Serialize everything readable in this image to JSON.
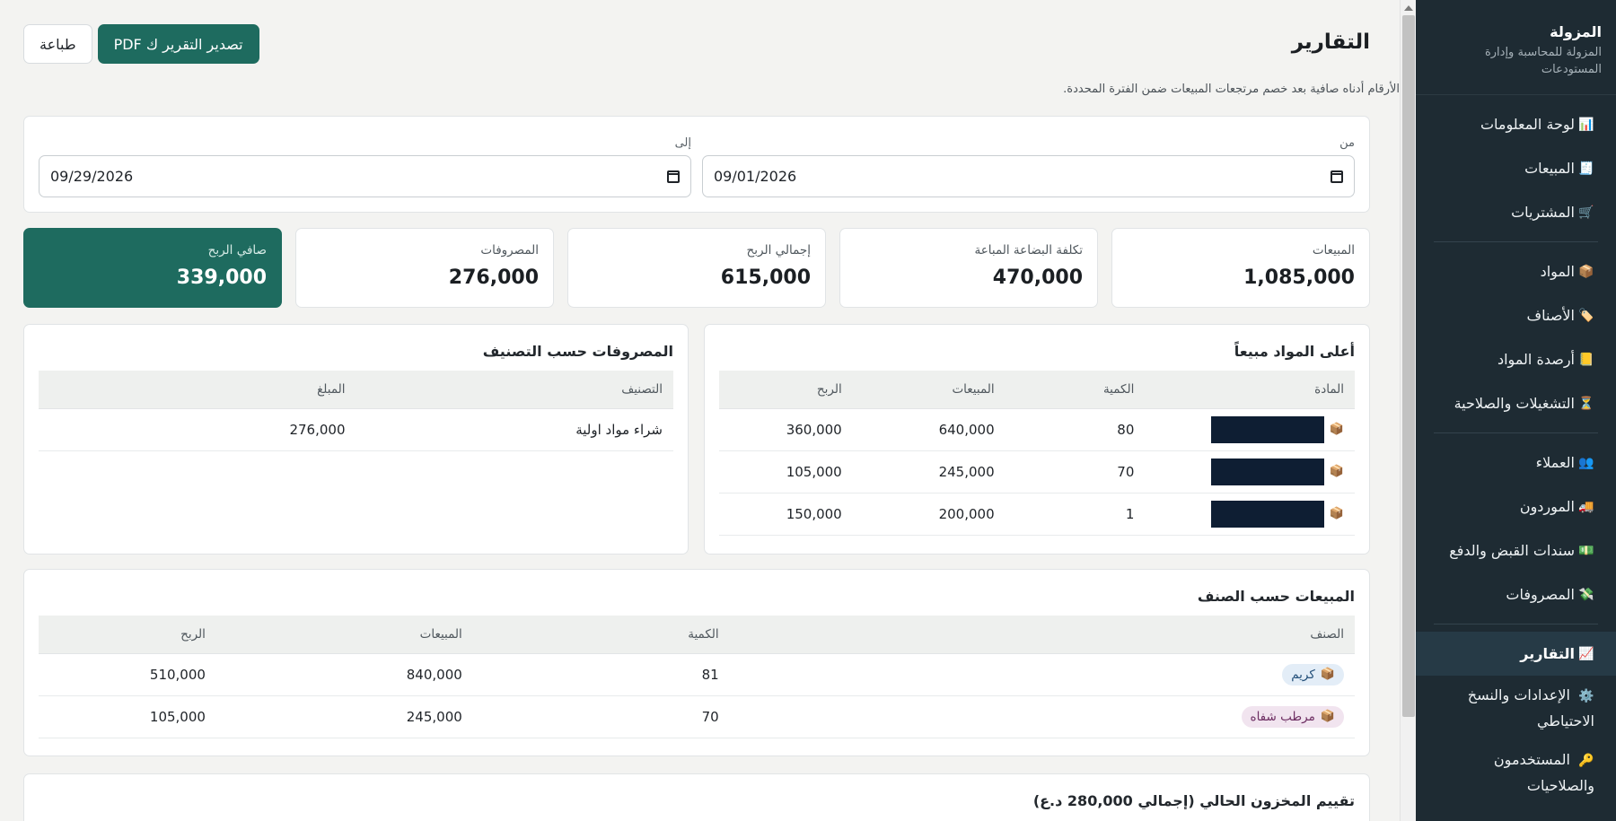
{
  "sidebar": {
    "title": "المزولة",
    "subtitle": "المزولة للمحاسبة وإدارة المستودعات",
    "items": [
      {
        "icon": "📊",
        "label": "لوحة المعلومات"
      },
      {
        "icon": "🧾",
        "label": "المبيعات"
      },
      {
        "icon": "🛒",
        "label": "المشتريات"
      },
      {
        "icon": "📦",
        "label": "المواد"
      },
      {
        "icon": "🏷️",
        "label": "الأصناف"
      },
      {
        "icon": "📒",
        "label": "أرصدة المواد"
      },
      {
        "icon": "⏳",
        "label": "التشغيلات والصلاحية"
      },
      {
        "icon": "👥",
        "label": "العملاء"
      },
      {
        "icon": "🚚",
        "label": "الموردون"
      },
      {
        "icon": "💵",
        "label": "سندات القبض والدفع"
      },
      {
        "icon": "💸",
        "label": "المصروفات"
      },
      {
        "icon": "📈",
        "label": "التقارير"
      },
      {
        "icon": "⚙️",
        "label": "الإعدادات والنسخ الاحتياطي"
      },
      {
        "icon": "🔑",
        "label": "المستخدمون والصلاحيات"
      }
    ]
  },
  "header": {
    "title": "التقارير",
    "note": "الأرقام أدناه صافية بعد خصم مرتجعات المبيعات ضمن الفترة المحددة.",
    "export_label": "تصدير التقرير ك PDF",
    "print_label": "طباعة"
  },
  "filter": {
    "from_label": "من",
    "from_value": "09/01/2026",
    "to_label": "إلى",
    "to_value": "09/29/2026"
  },
  "kpis": [
    {
      "label": "المبيعات",
      "value": "1,085,000"
    },
    {
      "label": "تكلفة البضاعة المباعة",
      "value": "470,000"
    },
    {
      "label": "إجمالي الربح",
      "value": "615,000"
    },
    {
      "label": "المصروفات",
      "value": "276,000"
    },
    {
      "label": "صافي الربح",
      "value": "339,000"
    }
  ],
  "top_items": {
    "title": "أعلى المواد مبيعاً",
    "columns": [
      "المادة",
      "الكمية",
      "المبيعات",
      "الربح"
    ],
    "rows": [
      {
        "qty": "80",
        "sales": "640,000",
        "profit": "360,000"
      },
      {
        "qty": "70",
        "sales": "245,000",
        "profit": "105,000"
      },
      {
        "qty": "1",
        "sales": "200,000",
        "profit": "150,000"
      }
    ]
  },
  "expenses": {
    "title": "المصروفات حسب التصنيف",
    "columns": [
      "التصنيف",
      "المبلغ"
    ],
    "rows": [
      {
        "category": "شراء مواد اولية",
        "amount": "276,000"
      }
    ]
  },
  "sales_by_category": {
    "title": "المبيعات حسب الصنف",
    "columns": [
      "الصنف",
      "الكمية",
      "المبيعات",
      "الربح"
    ],
    "rows": [
      {
        "category": "كريم",
        "qty": "81",
        "sales": "840,000",
        "profit": "510,000"
      },
      {
        "category": "مرطب شفاه",
        "qty": "70",
        "sales": "245,000",
        "profit": "105,000"
      }
    ]
  },
  "inventory": {
    "title": "تقييم المخزون الحالي (إجمالي 280,000 د.ع)"
  },
  "colors": {
    "primary": "#1e6b5f",
    "sidebar_bg": "#1e2b33",
    "page_bg": "#f3f3f1"
  }
}
